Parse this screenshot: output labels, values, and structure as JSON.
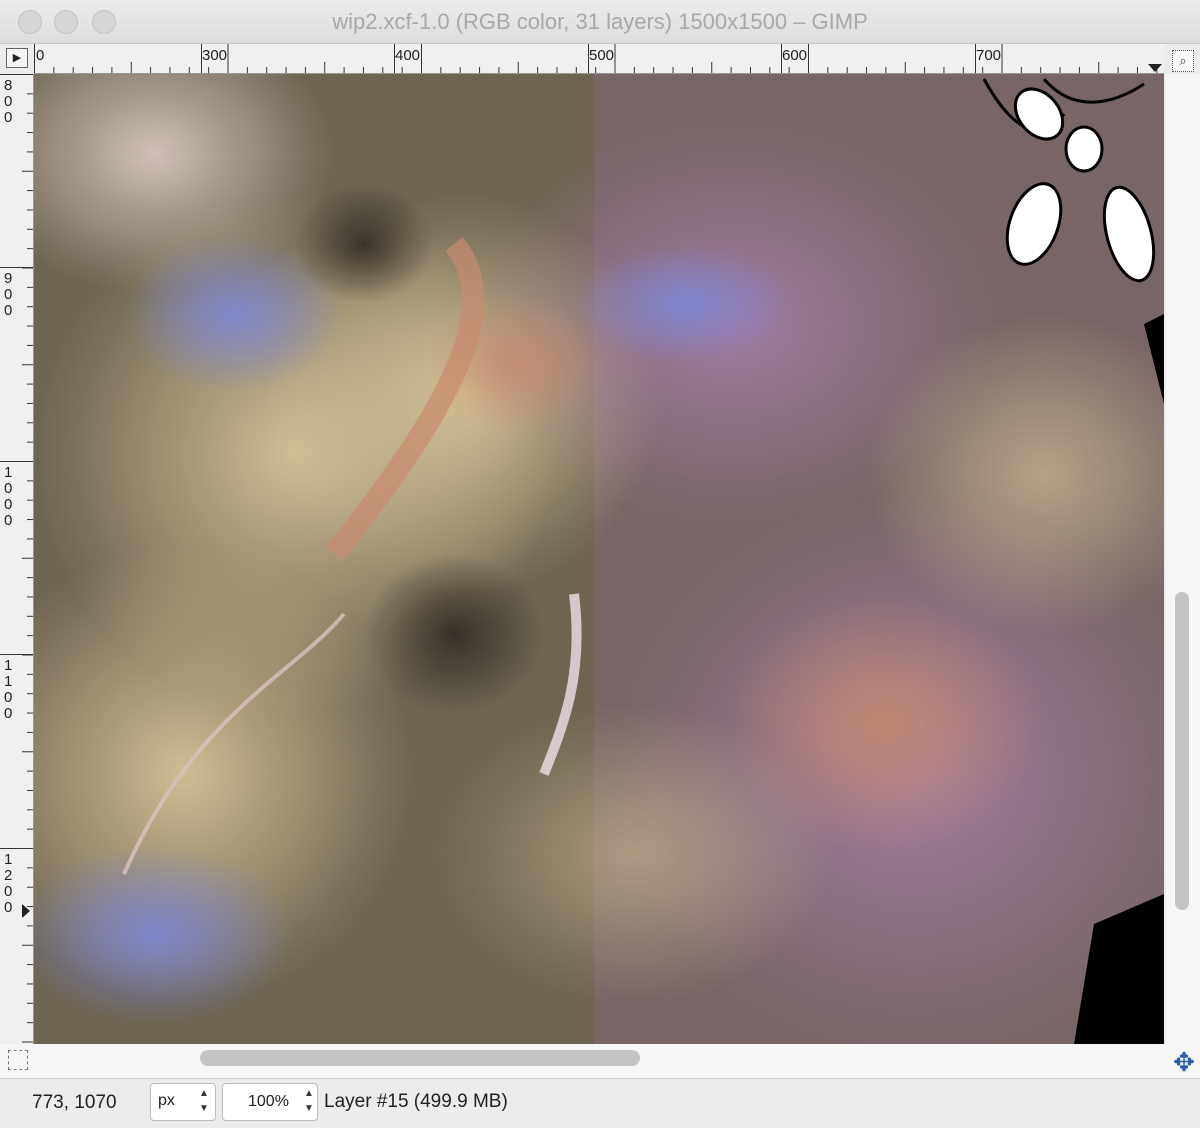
{
  "window": {
    "title": "wip2.xcf-1.0 (RGB color, 31 layers) 1500x1500 – GIMP"
  },
  "rulers": {
    "horizontal_labels": [
      "0",
      "300",
      "400",
      "500",
      "600",
      "700"
    ],
    "vertical_labels": [
      "800",
      "900",
      "1000",
      "1100",
      "1200"
    ]
  },
  "icons": {
    "navigate_menu": "triangle-right-icon",
    "zoom_toggle": "magnifier-icon",
    "quick_mask": "dashed-rectangle-icon",
    "navigate": "move-arrows-icon"
  },
  "statusbar": {
    "coords": "773, 1070",
    "unit": "px",
    "zoom": "100%",
    "layer_info": "Layer #15 (499.9 MB)"
  },
  "colors": {
    "navigate_icon": "#2b5ea8",
    "artwork_palette": [
      "#6d6452",
      "#8a6f83",
      "#b59a6b",
      "#7b86c4",
      "#c08273"
    ]
  }
}
